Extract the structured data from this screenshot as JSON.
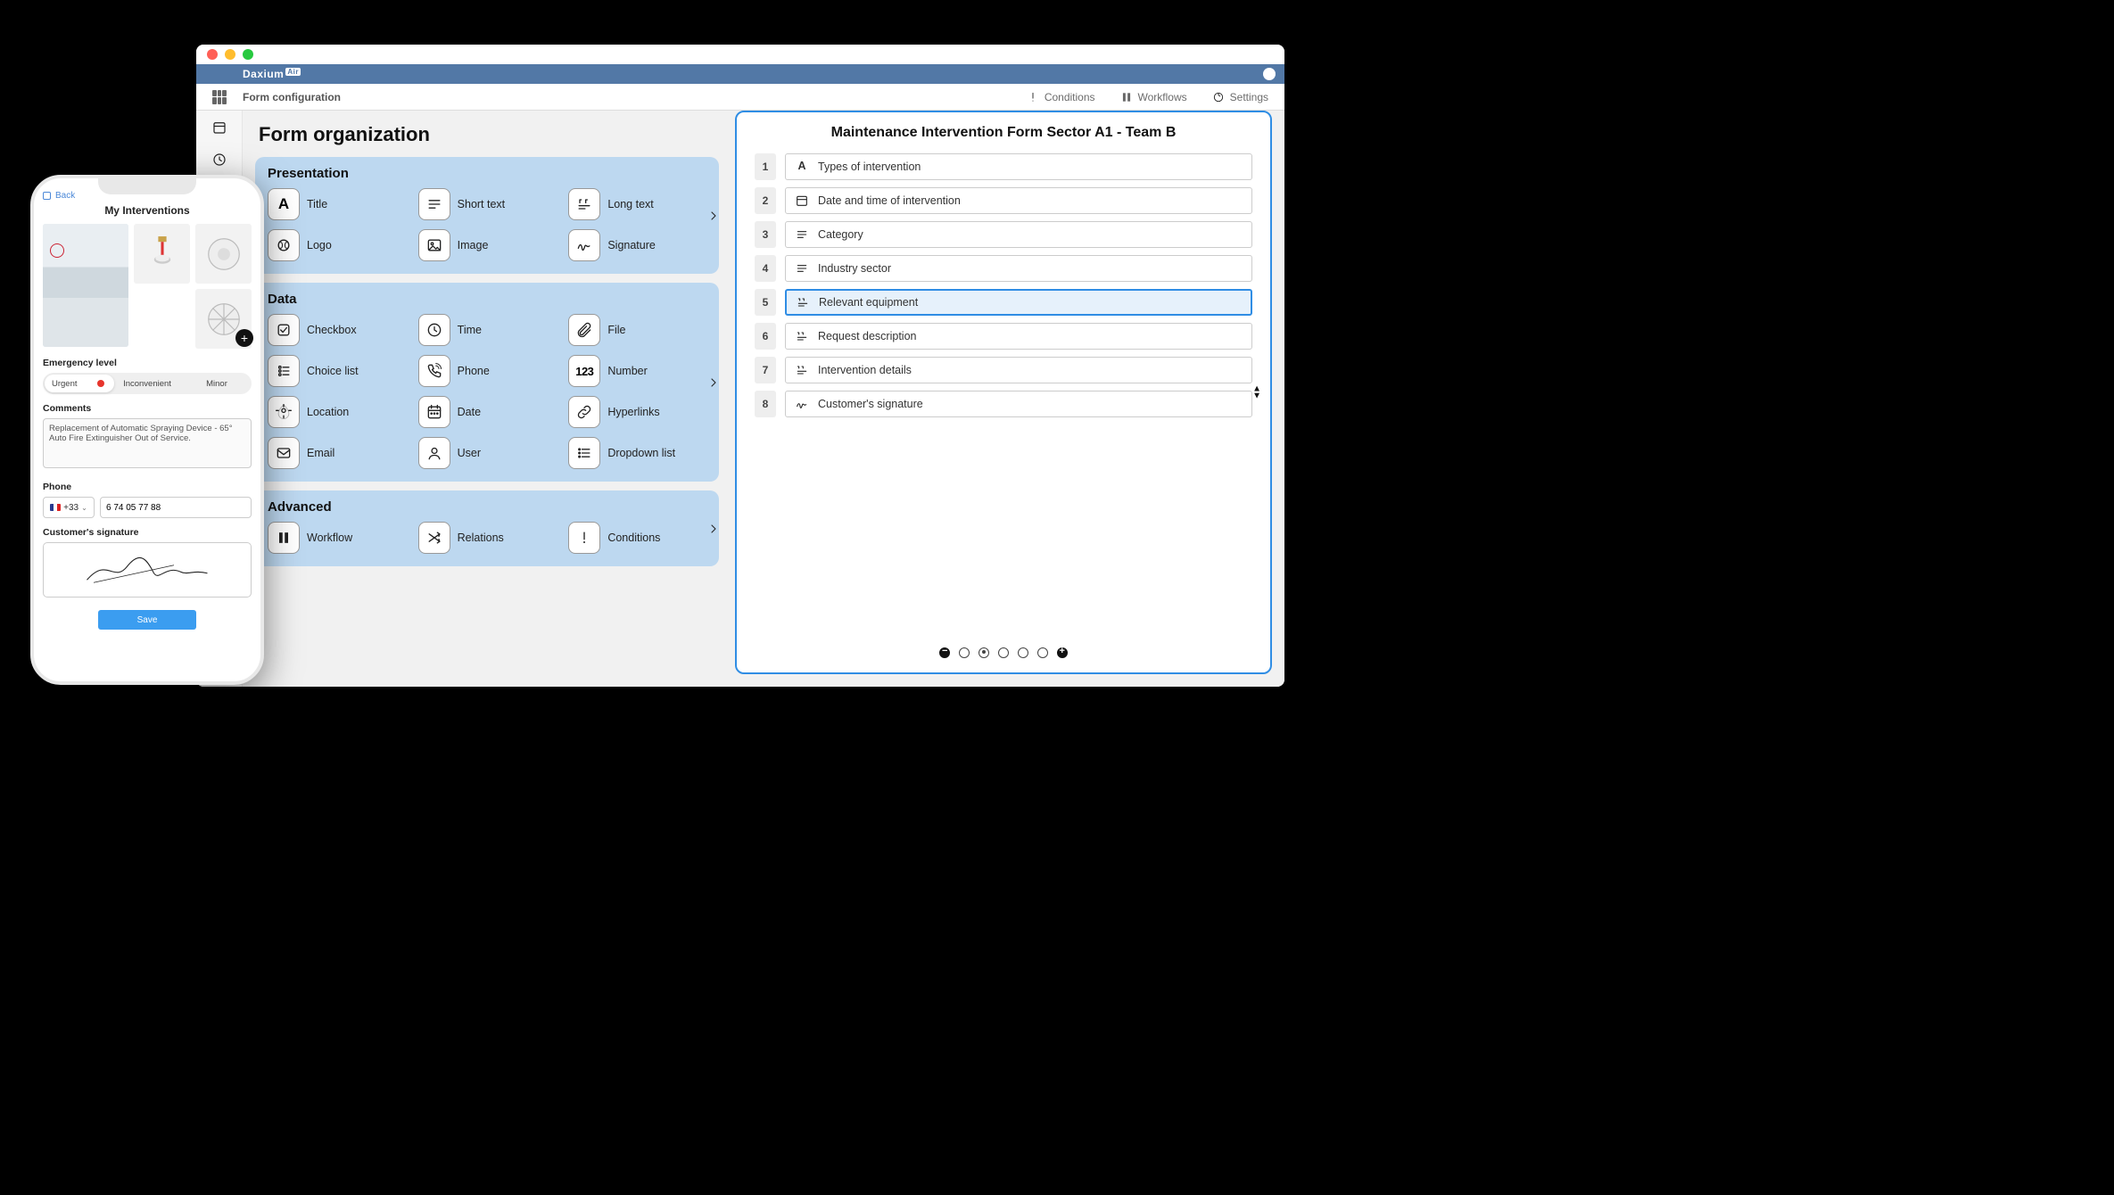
{
  "brand": "Daxium",
  "brand_suffix": "Air",
  "breadcrumb": "Form configuration",
  "toolbar": {
    "conditions": "Conditions",
    "workflows": "Workflows",
    "settings": "Settings"
  },
  "page_title": "Form organization",
  "sections": {
    "presentation": {
      "title": "Presentation",
      "tiles": {
        "title": "Title",
        "short_text": "Short text",
        "long_text": "Long text",
        "logo": "Logo",
        "image": "Image",
        "signature": "Signature"
      }
    },
    "data": {
      "title": "Data",
      "tiles": {
        "checkbox": "Checkbox",
        "time": "Time",
        "file": "File",
        "choice_list": "Choice list",
        "phone": "Phone",
        "number": "Number",
        "location": "Location",
        "date": "Date",
        "hyperlinks": "Hyperlinks",
        "email": "Email",
        "user": "User",
        "dropdown": "Dropdown list"
      }
    },
    "advanced": {
      "title": "Advanced",
      "tiles": {
        "workflow": "Workflow",
        "relations": "Relations",
        "conditions": "Conditions"
      }
    }
  },
  "form": {
    "title": "Maintenance Intervention Form Sector A1 - Team B",
    "fields": [
      {
        "n": "1",
        "label": "Types of intervention",
        "icon": "text"
      },
      {
        "n": "2",
        "label": "Date and time of intervention",
        "icon": "date"
      },
      {
        "n": "3",
        "label": "Category",
        "icon": "list"
      },
      {
        "n": "4",
        "label": "Industry sector",
        "icon": "list"
      },
      {
        "n": "5",
        "label": "Relevant equipment",
        "icon": "long"
      },
      {
        "n": "6",
        "label": "Request description",
        "icon": "long"
      },
      {
        "n": "7",
        "label": "Intervention details",
        "icon": "long"
      },
      {
        "n": "8",
        "label": "Customer's signature",
        "icon": "sig"
      }
    ],
    "selected_index": 4
  },
  "phone": {
    "back": "Back",
    "title": "My Interventions",
    "labels": {
      "emergency": "Emergency level",
      "comments": "Comments",
      "phone": "Phone",
      "signature": "Customer's signature"
    },
    "segments": {
      "urgent": "Urgent",
      "inconvenient": "Inconvenient",
      "minor": "Minor"
    },
    "comments_value": "Replacement of Automatic Spraying Device - 65° Auto Fire Extinguisher Out of Service.",
    "country_code": "+33",
    "phone_number": "6 74 05 77 88",
    "save": "Save"
  }
}
